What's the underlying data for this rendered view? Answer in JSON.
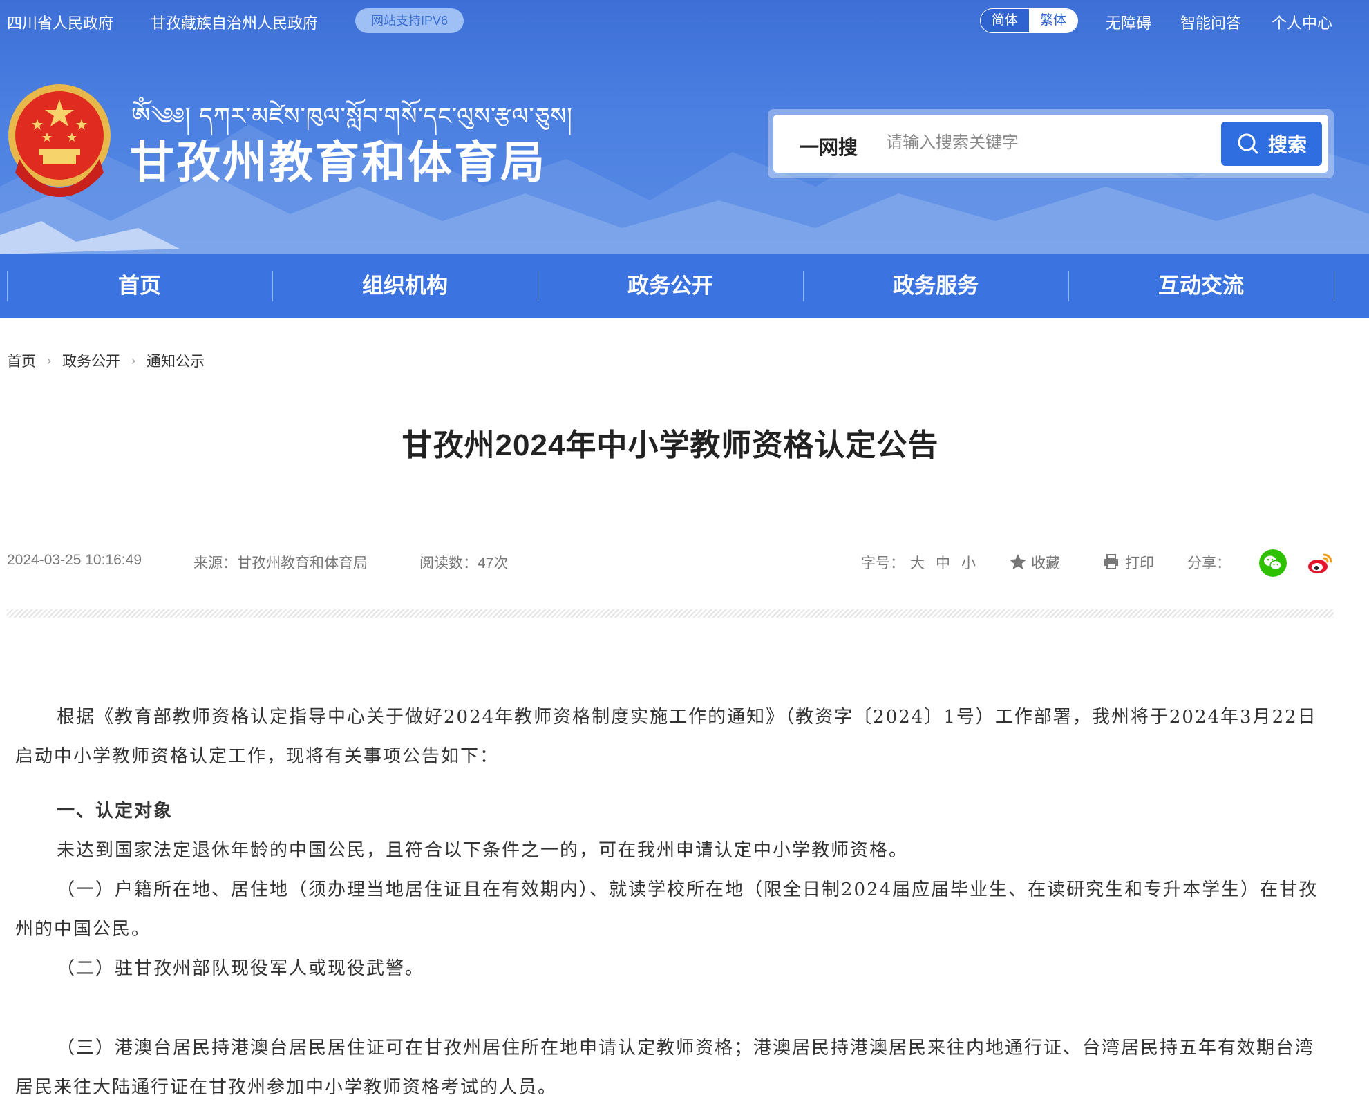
{
  "topbar": {
    "links": [
      "四川省人民政府",
      "甘孜藏族自治州人民政府"
    ],
    "ipv6_badge": "网站支持IPV6",
    "lang_simplified": "简体",
    "lang_traditional": "繁体",
    "right_links": [
      "无障碍",
      "智能问答",
      "个人中心"
    ]
  },
  "header": {
    "tibetan_title": "ༀ༄༅། དཀར་མཛེས་ཁུལ་སློབ་གསོ་དང་ལུས་རྩལ་ཅུས།",
    "site_title": "甘孜州教育和体育局"
  },
  "search": {
    "scope_label": "一网搜",
    "placeholder": "请输入搜索关键字",
    "button_label": "搜索"
  },
  "nav": {
    "items": [
      "首页",
      "组织机构",
      "政务公开",
      "政务服务",
      "互动交流"
    ]
  },
  "breadcrumb": [
    "首页",
    "政务公开",
    "通知公示"
  ],
  "article": {
    "title": "甘孜州2024年中小学教师资格认定公告",
    "date": "2024-03-25 10:16:49",
    "source": "来源：甘孜州教育和体育局",
    "reads": "阅读数：47次",
    "font_size_label": "字号：",
    "font_sizes": [
      "大",
      "中",
      "小"
    ],
    "favorite": "收藏",
    "print": "打印",
    "share": "分享：",
    "paragraphs": [
      "根据《教育部教师资格认定指导中心关于做好2024年教师资格制度实施工作的通知》（教资字〔2024〕1号）工作部署，我州将于2024年3月22日启动中小学教师资格认定工作，现将有关事项公告如下：",
      "一、认定对象",
      "未达到国家法定退休年龄的中国公民，且符合以下条件之一的，可在我州申请认定中小学教师资格。",
      "（一）户籍所在地、居住地（须办理当地居住证且在有效期内）、就读学校所在地（限全日制2024届应届毕业生、在读研究生和专升本学生）在甘孜州的中国公民。",
      "（二）驻甘孜州部队现役军人或现役武警。",
      "（三）港澳台居民持港澳台居民居住证可在甘孜州居住所在地申请认定教师资格；港澳居民持港澳居民来往内地通行证、台湾居民持五年有效期台湾居民来往大陆通行证在甘孜州参加中小学教师资格考试的人员。"
    ]
  },
  "icons": {
    "emblem": "national-emblem-icon",
    "search": "search-icon",
    "star": "star-icon",
    "printer": "printer-icon",
    "wechat": "wechat-icon",
    "weibo": "weibo-icon"
  },
  "colors": {
    "header_blue": "#3d6fd6",
    "nav_blue": "#3b73e0",
    "search_button": "#2f6ee0",
    "wechat_green": "#2dc100",
    "weibo_red": "#e6162d"
  }
}
